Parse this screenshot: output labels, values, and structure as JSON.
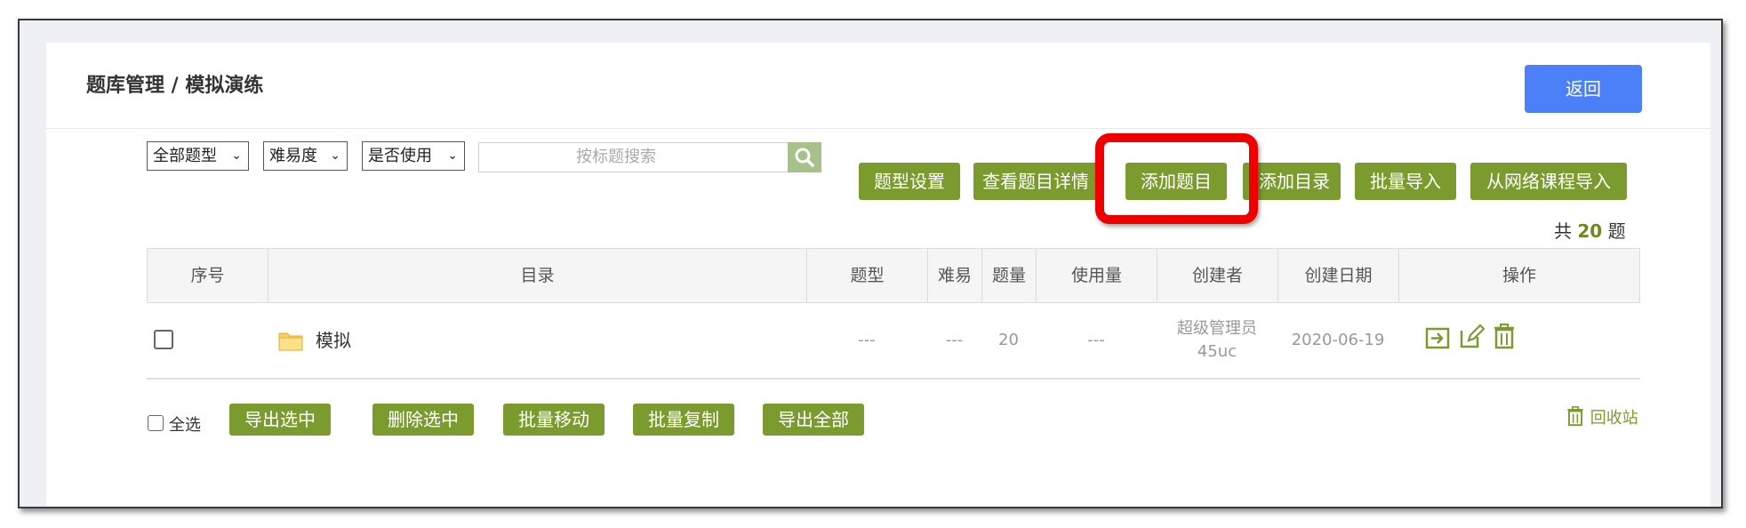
{
  "breadcrumb": "题库管理 / 模拟演练",
  "back_label": "返回",
  "filters": {
    "type": "全部题型",
    "difficulty": "难易度",
    "used": "是否使用"
  },
  "search": {
    "placeholder": "按标题搜索"
  },
  "toolbar": {
    "type_settings": "题型设置",
    "view_details": "查看题目详情",
    "add_question": "添加题目",
    "add_dir": "添加目录",
    "batch_import": "批量导入",
    "import_from_course": "从网络课程导入"
  },
  "total": {
    "prefix": "共",
    "count": "20",
    "suffix": "题"
  },
  "table": {
    "headers": [
      "序号",
      "目录",
      "题型",
      "难易",
      "题量",
      "使用量",
      "创建者",
      "创建日期",
      "操作"
    ],
    "rows": [
      {
        "name": "模拟",
        "type": "---",
        "difficulty": "---",
        "count": "20",
        "usage": "---",
        "creator_line1": "超级管理员",
        "creator_line2": "45uc",
        "date": "2020-06-19"
      }
    ]
  },
  "footer": {
    "select_all": "全选",
    "export_selected": "导出选中",
    "delete_selected": "删除选中",
    "batch_move": "批量移动",
    "batch_copy": "批量复制",
    "export_all": "导出全部",
    "recycle_bin": "回收站"
  },
  "colors": {
    "accent_green": "#7b9b2e",
    "back_blue": "#4b80f8",
    "highlight_red": "#ee0000"
  }
}
